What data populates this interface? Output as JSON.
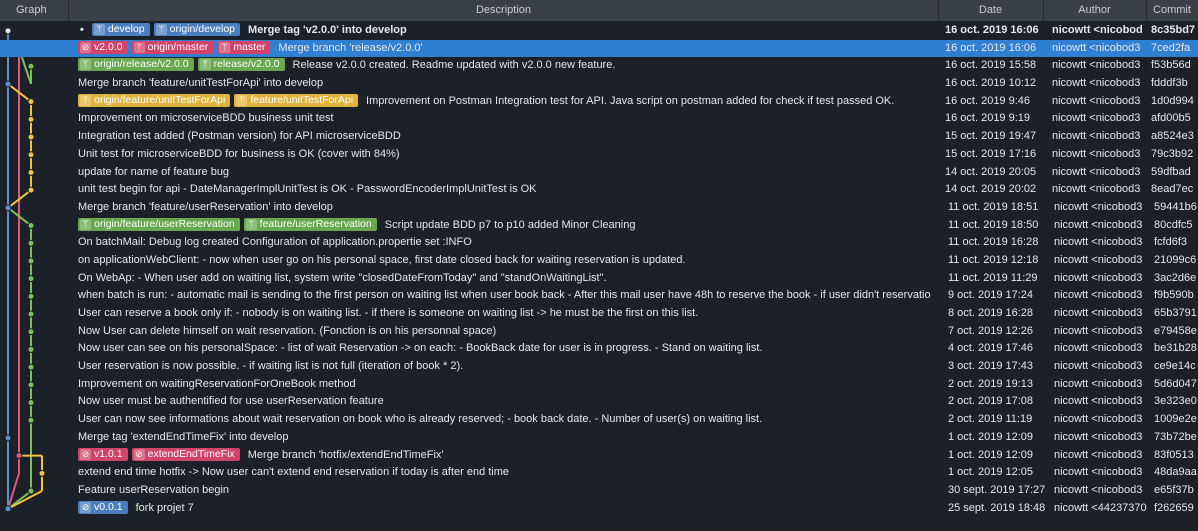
{
  "header": {
    "graph": "Graph",
    "description": "Description",
    "date": "Date",
    "author": "Author",
    "commit": "Commit"
  },
  "colors": {
    "selection": "#2f7fd3",
    "branch_blue": "#4a7fbf",
    "branch_red": "#d2436a",
    "branch_green": "#6aa84f",
    "branch_yellow": "#e0b43c"
  },
  "commits": [
    {
      "tags": [
        {
          "label": "develop",
          "kind": "branch",
          "color": "blue"
        },
        {
          "label": "origin/develop",
          "kind": "branch",
          "color": "blue"
        }
      ],
      "message": "Merge tag 'v2.0.0' into develop",
      "date": "16 oct. 2019 16:06",
      "author": "nicowtt <nicobod",
      "commit": "8c35bd7"
    },
    {
      "tags": [
        {
          "label": "v2.0.0",
          "kind": "tag",
          "color": "red"
        },
        {
          "label": "origin/master",
          "kind": "branch",
          "color": "red"
        },
        {
          "label": "master",
          "kind": "branch",
          "color": "red"
        }
      ],
      "message": "Merge branch 'release/v2.0.0'",
      "date": "16 oct. 2019 16:06",
      "author": "nicowtt <nicobod3",
      "commit": "7ced2fa"
    },
    {
      "tags": [
        {
          "label": "origin/release/v2.0.0",
          "kind": "branch",
          "color": "green"
        },
        {
          "label": "release/v2.0.0",
          "kind": "branch",
          "color": "green"
        }
      ],
      "message": "Release v2.0.0 created. Readme updated with v2.0.0 new feature.",
      "date": "16 oct. 2019 15:58",
      "author": "nicowtt <nicobod3",
      "commit": "f53b56d"
    },
    {
      "tags": [],
      "message": "Merge branch 'feature/unitTestForApi' into develop",
      "date": "16 oct. 2019 10:12",
      "author": "nicowtt <nicobod3",
      "commit": "fdddf3b"
    },
    {
      "tags": [
        {
          "label": "origin/feature/unitTestForApi",
          "kind": "branch",
          "color": "yellow"
        },
        {
          "label": "feature/unitTestForApi",
          "kind": "branch",
          "color": "yellow"
        }
      ],
      "message": "Improvement on Postman Integration test for API. Java script on postman added for check if test passed OK.",
      "date": "16 oct. 2019 9:46",
      "author": "nicowtt <nicobod3",
      "commit": "1d0d994"
    },
    {
      "tags": [],
      "message": "Improvement on microserviceBDD business unit test",
      "date": "16 oct. 2019 9:19",
      "author": "nicowtt <nicobod3",
      "commit": "afd00b5"
    },
    {
      "tags": [],
      "message": "Integration test added (Postman version)  for API microserviceBDD",
      "date": "15 oct. 2019 19:47",
      "author": "nicowtt <nicobod3",
      "commit": "a8524e3"
    },
    {
      "tags": [],
      "message": "Unit test for microserviceBDD for business is OK (cover with 84%)",
      "date": "15 oct. 2019 17:16",
      "author": "nicowtt <nicobod3",
      "commit": "79c3b92"
    },
    {
      "tags": [],
      "message": "update for name of feature bug",
      "date": "14 oct. 2019 20:05",
      "author": "nicowtt <nicobod3",
      "commit": "59dfbad"
    },
    {
      "tags": [],
      "message": "unit test begin for api - DateManagerImplUnitTest is OK - PasswordEncoderImplUnitTest is OK",
      "date": "14 oct. 2019 20:02",
      "author": "nicowtt <nicobod3",
      "commit": "8ead7ec"
    },
    {
      "tags": [],
      "message": "Merge branch 'feature/userReservation' into develop",
      "date": "11 oct. 2019 18:51",
      "author": "nicowtt <nicobod3",
      "commit": "59441b6"
    },
    {
      "tags": [
        {
          "label": "origin/feature/userReservation",
          "kind": "branch",
          "color": "green"
        },
        {
          "label": "feature/userReservation",
          "kind": "branch",
          "color": "green"
        }
      ],
      "message": "Script update BDD p7 to p10 added Minor Cleaning",
      "date": "11 oct. 2019 18:50",
      "author": "nicowtt <nicobod3",
      "commit": "80cdfc5"
    },
    {
      "tags": [],
      "message": "On batchMail: Debug log created Configuration of application.propertie set :INFO",
      "date": "11 oct. 2019 16:28",
      "author": "nicowtt <nicobod3",
      "commit": "fcfd6f3"
    },
    {
      "tags": [],
      "message": "on applicationWebClient: - now when user go on his personal space, first date closed back for waiting reservation is updated.",
      "date": "11 oct. 2019 12:18",
      "author": "nicowtt <nicobod3",
      "commit": "21099c6"
    },
    {
      "tags": [],
      "message": "On WebAp: - When user add on waiting list, system write \"closedDateFromToday\" and  \"standOnWaitingList\".",
      "date": "11 oct. 2019 11:29",
      "author": "nicowtt <nicobod3",
      "commit": "3ac2d6e"
    },
    {
      "tags": [],
      "message": "when batch is run: - automatic mail is sending to the first person on waiting list when user book back - After this mail user have 48h to reserve the book - if user didn't reservatio",
      "date": "9 oct. 2019 17:24",
      "author": "nicowtt <nicobod3",
      "commit": "f9b590b"
    },
    {
      "tags": [],
      "message": "User can reserve a book only if: - nobody is on waiting list. - if there is someone on waiting list -> he must be the first on this list.",
      "date": "8 oct. 2019 16:28",
      "author": "nicowtt <nicobod3",
      "commit": "65b3791"
    },
    {
      "tags": [],
      "message": "Now User can delete himself on wait reservation. (Fonction is on his personnal space)",
      "date": "7 oct. 2019 12:26",
      "author": "nicowtt <nicobod3",
      "commit": "e79458e"
    },
    {
      "tags": [],
      "message": "Now user can see on his personalSpace: - list of wait Reservation -> on each: - BookBack date for user is in progress. - Stand on waiting list.",
      "date": "4 oct. 2019 17:46",
      "author": "nicowtt <nicobod3",
      "commit": "be31b28"
    },
    {
      "tags": [],
      "message": "User reservation is now possible. - if waiting list is not full (iteration of book * 2).",
      "date": "3 oct. 2019 17:43",
      "author": "nicowtt <nicobod3",
      "commit": "ce9e14c"
    },
    {
      "tags": [],
      "message": "Improvement on waitingReservationForOneBook method",
      "date": "2 oct. 2019 19:13",
      "author": "nicowtt <nicobod3",
      "commit": "5d6d047"
    },
    {
      "tags": [],
      "message": "Now user must be authentified for use userReservation feature",
      "date": "2 oct. 2019 17:08",
      "author": "nicowtt <nicobod3",
      "commit": "3e323e0"
    },
    {
      "tags": [],
      "message": "User can now see informations about wait reservation on book who is already reserved; - book back date. - Number of user(s) on waiting list.",
      "date": "2 oct. 2019 11:19",
      "author": "nicowtt <nicobod3",
      "commit": "1009e2e"
    },
    {
      "tags": [],
      "message": "Merge tag 'extendEndTimeFix' into develop",
      "date": "1 oct. 2019 12:09",
      "author": "nicowtt <nicobod3",
      "commit": "73b72be"
    },
    {
      "tags": [
        {
          "label": "v1.0.1",
          "kind": "tag",
          "color": "red"
        },
        {
          "label": "extendEndTimeFix",
          "kind": "tag",
          "color": "red"
        }
      ],
      "message": "Merge branch 'hotfix/extendEndTimeFix'",
      "date": "1 oct. 2019 12:09",
      "author": "nicowtt <nicobod3",
      "commit": "83f0513"
    },
    {
      "tags": [],
      "message": "extend end time hotfix -> Now user can't extend end reservation if today is after end time",
      "date": "1 oct. 2019 12:05",
      "author": "nicowtt <nicobod3",
      "commit": "48da9aa"
    },
    {
      "tags": [],
      "message": "Feature userReservation begin",
      "date": "30 sept. 2019 17:27",
      "author": "nicowtt <nicobod3",
      "commit": "e65f37b"
    },
    {
      "tags": [
        {
          "label": "v0.0.1",
          "kind": "tag",
          "color": "navy"
        }
      ],
      "message": "fork projet 7",
      "date": "25 sept. 2019 18:48",
      "author": "nicowtt <44237370",
      "commit": "f262659"
    }
  ]
}
